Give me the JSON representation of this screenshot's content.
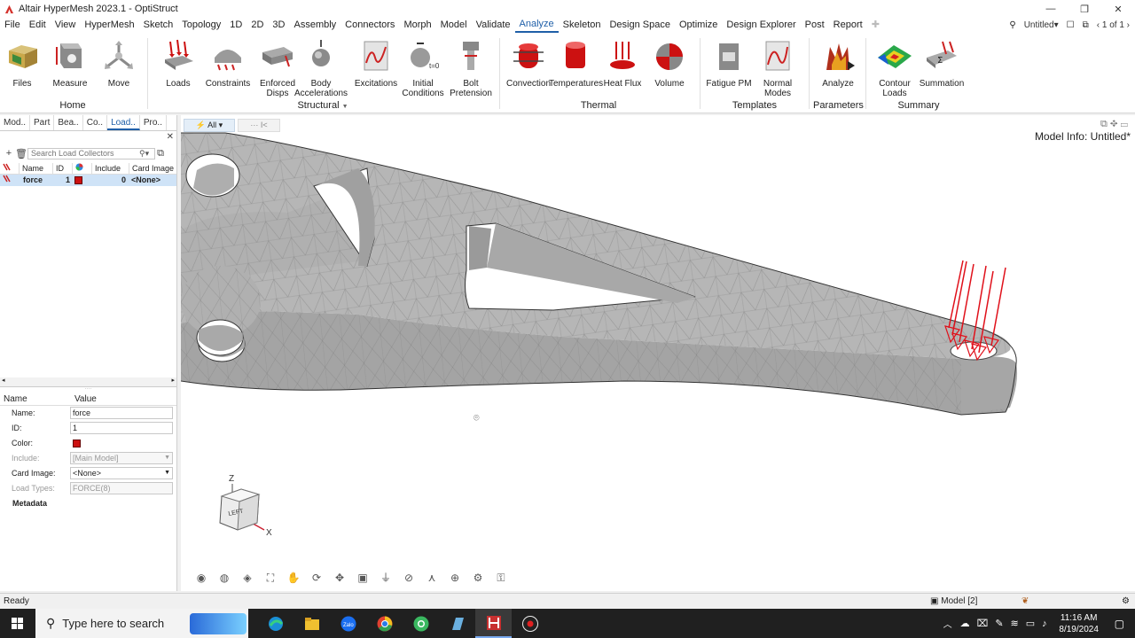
{
  "window": {
    "title": "Altair HyperMesh 2023.1 - OptiStruct",
    "minimize": "—",
    "restore": "❐",
    "close": "✕"
  },
  "menubar": {
    "items": [
      "File",
      "Edit",
      "View",
      "HyperMesh",
      "Sketch",
      "Topology",
      "1D",
      "2D",
      "3D",
      "Assembly",
      "Connectors",
      "Morph",
      "Model",
      "Validate",
      "Analyze",
      "Skeleton",
      "Design Space",
      "Optimize",
      "Design Explorer",
      "Post",
      "Report"
    ],
    "active": "Analyze",
    "session": "Untitled",
    "page": "1 of 1"
  },
  "ribbon": {
    "tools": [
      {
        "id": "files",
        "label": "Files"
      },
      {
        "id": "measure",
        "label": "Measure"
      },
      {
        "id": "move",
        "label": "Move"
      },
      {
        "id": "loads",
        "label": "Loads"
      },
      {
        "id": "constraints",
        "label": "Constraints"
      },
      {
        "id": "enforced-disps",
        "label": "Enforced Disps"
      },
      {
        "id": "body-accelerations",
        "label": "Body Accelerations"
      },
      {
        "id": "excitations",
        "label": "Excitations"
      },
      {
        "id": "initial-conditions",
        "label": "Initial Conditions"
      },
      {
        "id": "bolt-pretension",
        "label": "Bolt Pretension"
      },
      {
        "id": "convection",
        "label": "Convection"
      },
      {
        "id": "temperatures",
        "label": "Temperatures"
      },
      {
        "id": "heat-flux",
        "label": "Heat Flux"
      },
      {
        "id": "volume",
        "label": "Volume"
      },
      {
        "id": "fatigue-pm",
        "label": "Fatigue PM"
      },
      {
        "id": "normal-modes",
        "label": "Normal Modes"
      },
      {
        "id": "analyze",
        "label": "Analyze"
      },
      {
        "id": "contour-loads",
        "label": "Contour Loads"
      },
      {
        "id": "summation",
        "label": "Summation"
      }
    ],
    "groups": {
      "home": "Home",
      "structural": "Structural",
      "thermal": "Thermal",
      "templates": "Templates",
      "parameters": "Parameters",
      "summary": "Summary"
    }
  },
  "left_panel": {
    "tabs": [
      "Mod..",
      "Part",
      "Bea..",
      "Co..",
      "Load..",
      "Pro.."
    ],
    "active_tab": "Load..",
    "search_placeholder": "Search Load Collectors",
    "columns": [
      "Name",
      "ID",
      "",
      "Include",
      "Card Image"
    ],
    "rows": [
      {
        "name": "force",
        "id": "1",
        "color": "#cc1111",
        "include": "0",
        "card_image": "<None>"
      }
    ],
    "props_header": [
      "Name",
      "Value"
    ],
    "props": {
      "name_label": "Name:",
      "name_value": "force",
      "id_label": "ID:",
      "id_value": "1",
      "color_label": "Color:",
      "color_value": "#cc1111",
      "include_label": "Include:",
      "include_value": "[Main Model]",
      "card_label": "Card Image:",
      "card_value": "<None>",
      "loadtypes_label": "Load Types:",
      "loadtypes_value": "FORCE(8)",
      "metadata_label": "Metadata"
    }
  },
  "viewport": {
    "filter_label": "All",
    "filter2": "···   I<",
    "model_info": "Model Info: Untitled*",
    "axis": {
      "z": "Z",
      "x": "X",
      "cube_face": "LEFT"
    },
    "load_color": "#e0101a"
  },
  "status": {
    "text": "Ready",
    "model": "Model [2]"
  },
  "taskbar": {
    "search_placeholder": "Type here to search",
    "time": "11:16 AM",
    "date": "8/19/2024"
  }
}
